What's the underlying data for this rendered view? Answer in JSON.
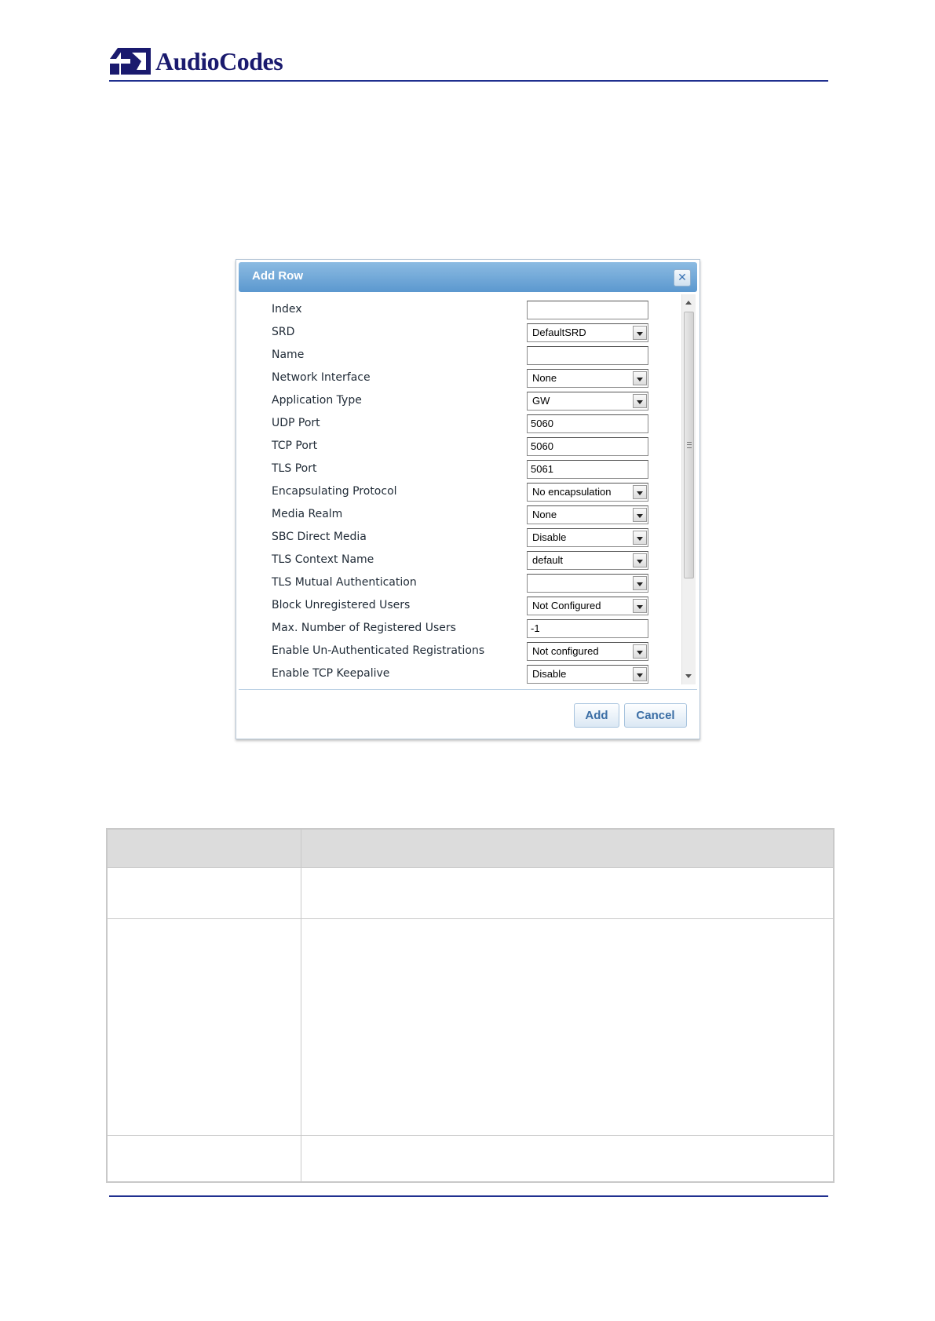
{
  "header": {
    "brand": "AudioCodes"
  },
  "dialog": {
    "title": "Add Row",
    "fields": [
      {
        "label": "Index",
        "value": "",
        "type": "text"
      },
      {
        "label": "SRD",
        "value": "DefaultSRD",
        "type": "select"
      },
      {
        "label": "Name",
        "value": "",
        "type": "text"
      },
      {
        "label": "Network Interface",
        "value": "None",
        "type": "select"
      },
      {
        "label": "Application Type",
        "value": "GW",
        "type": "select"
      },
      {
        "label": "UDP Port",
        "value": "5060",
        "type": "text"
      },
      {
        "label": "TCP Port",
        "value": "5060",
        "type": "text"
      },
      {
        "label": "TLS Port",
        "value": "5061",
        "type": "text"
      },
      {
        "label": "Encapsulating Protocol",
        "value": "No encapsulation",
        "type": "select"
      },
      {
        "label": "Media Realm",
        "value": "None",
        "type": "select"
      },
      {
        "label": "SBC Direct Media",
        "value": "Disable",
        "type": "select"
      },
      {
        "label": "TLS Context Name",
        "value": "default",
        "type": "select"
      },
      {
        "label": "TLS Mutual Authentication",
        "value": "",
        "type": "select"
      },
      {
        "label": "Block Unregistered Users",
        "value": "Not Configured",
        "type": "select"
      },
      {
        "label": "Max. Number of Registered Users",
        "value": "-1",
        "type": "text"
      },
      {
        "label": "Enable Un-Authenticated Registrations",
        "value": "Not configured",
        "type": "select"
      },
      {
        "label": "Enable TCP Keepalive",
        "value": "Disable",
        "type": "select"
      }
    ],
    "buttons": {
      "add": "Add",
      "cancel": "Cancel"
    },
    "close_glyph": "✕"
  },
  "colors": {
    "title_bar": "#6aa5d8",
    "rule": "#1f2f8f",
    "button_text": "#3b6ea5"
  },
  "icons": [
    "audiocodes-logo-icon",
    "close-icon",
    "chevron-down-icon",
    "scroll-up-icon",
    "scroll-down-icon"
  ]
}
